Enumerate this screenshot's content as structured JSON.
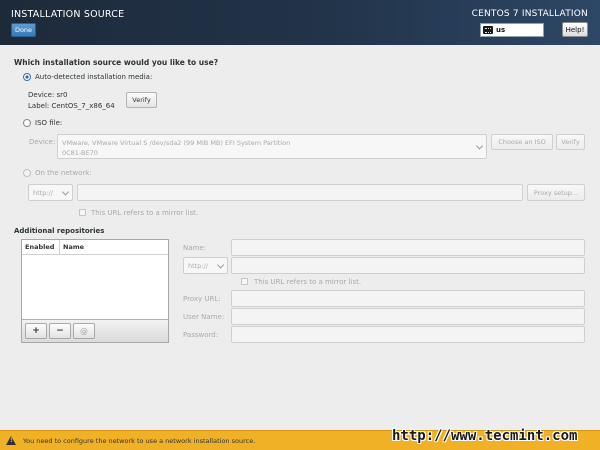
{
  "header": {
    "title": "INSTALLATION SOURCE",
    "product": "CENTOS 7 INSTALLATION",
    "done_label": "Done",
    "keyboard_layout": "us",
    "help_label": "Help!"
  },
  "source": {
    "question": "Which installation source would you like to use?",
    "auto_label": "Auto-detected installation media:",
    "device_label": "Device: sr0",
    "label_label": "Label: CentOS_7_x86_64",
    "verify_label": "Verify",
    "iso_label": "ISO file:",
    "iso_device_label": "Device:",
    "iso_device_value_line1": "VMware, VMware Virtual S /dev/sda2 (99 MiB MB) EFI System Partition",
    "iso_device_value_line2": "0C81-BE70",
    "choose_iso_label": "Choose an ISO",
    "iso_verify_label": "Verify",
    "network_label": "On the network:",
    "protocol_value": "http://",
    "proxy_setup_label": "Proxy setup...",
    "mirror_list_label": "This URL refers to a mirror list."
  },
  "repos": {
    "heading": "Additional repositories",
    "col_enabled": "Enabled",
    "col_name": "Name",
    "add_symbol": "+",
    "remove_symbol": "−",
    "reset_symbol": "@",
    "name_label": "Name:",
    "protocol_value": "http://",
    "mirror_list_label": "This URL refers to a mirror list.",
    "proxy_url_label": "Proxy URL:",
    "user_name_label": "User Name:",
    "password_label": "Password:"
  },
  "status": {
    "message": "You need to configure the network to use a network installation source."
  },
  "watermark": "http://www.tecmint.com",
  "colors": {
    "header_bg": "#1d2a3a",
    "accent": "#3a6fb0",
    "warning_bar": "#f0b127"
  }
}
